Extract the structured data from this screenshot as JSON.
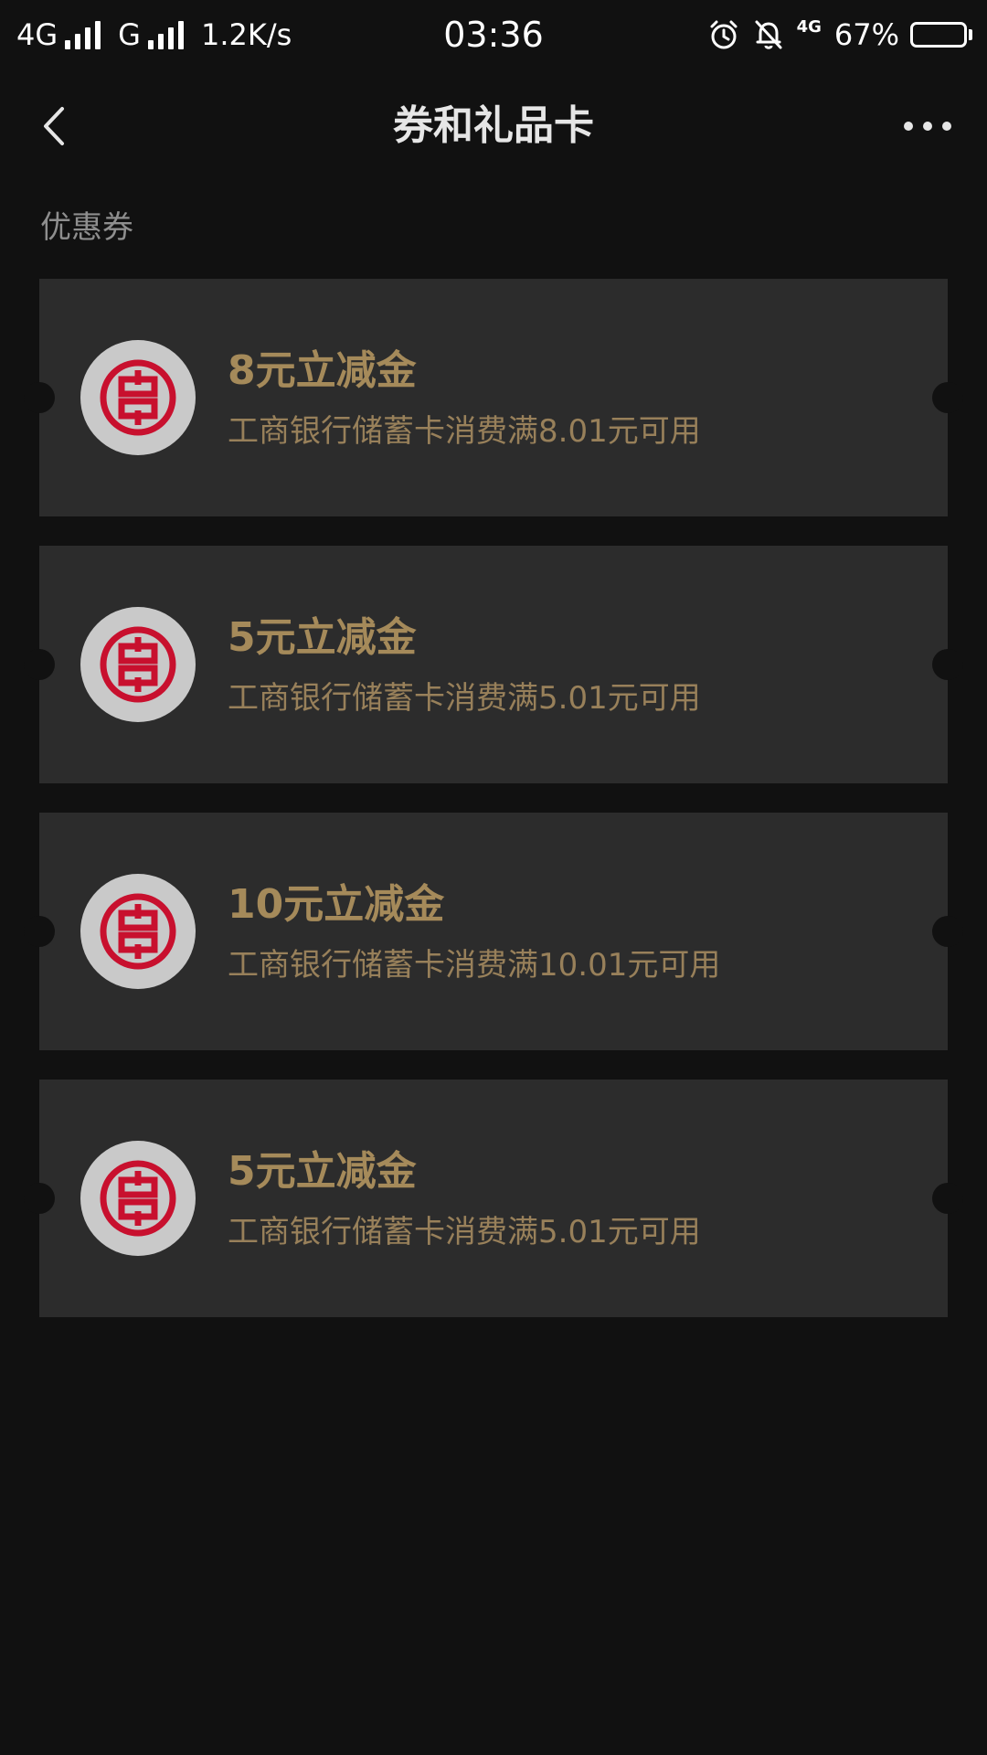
{
  "status_bar": {
    "network1": "4G",
    "network2": "G",
    "speed": "1.2K/s",
    "time": "03:36",
    "network3": "4G",
    "battery_percent": "67%",
    "battery_level": 0.67,
    "icons": [
      "signal-icon",
      "signal-icon",
      "alarm-icon",
      "bell-muted-icon",
      "battery-icon"
    ]
  },
  "nav": {
    "title": "券和礼品卡",
    "back_icon": "chevron-left-icon",
    "more_icon": "more-dots-icon"
  },
  "section": {
    "title": "优惠券"
  },
  "coupons": [
    {
      "title": "8元立减金",
      "desc": "工商银行储蓄卡消费满8.01元可用"
    },
    {
      "title": "5元立减金",
      "desc": "工商银行储蓄卡消费满5.01元可用"
    },
    {
      "title": "10元立减金",
      "desc": "工商银行储蓄卡消费满10.01元可用"
    },
    {
      "title": "5元立减金",
      "desc": "工商银行储蓄卡消费满5.01元可用"
    }
  ],
  "colors": {
    "background": "#111111",
    "card": "#2c2c2c",
    "gold": "#a58a5a",
    "icbc_red": "#c8102e"
  }
}
